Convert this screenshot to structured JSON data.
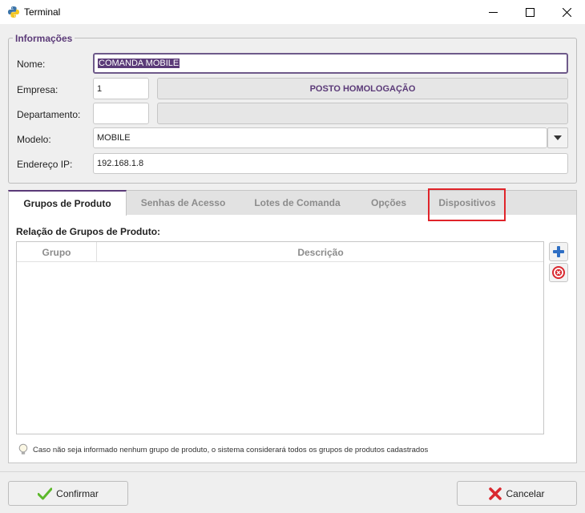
{
  "window": {
    "title": "Terminal",
    "app_icon": "python-icon"
  },
  "info_section": {
    "legend": "Informações",
    "nome_label": "Nome:",
    "nome_value": "COMANDA MOBILE",
    "empresa_label": "Empresa:",
    "empresa_code": "1",
    "empresa_name": "POSTO HOMOLOGAÇÃO",
    "departamento_label": "Departamento:",
    "departamento_code": "",
    "departamento_name": "",
    "modelo_label": "Modelo:",
    "modelo_value": "MOBILE",
    "ip_label": "Endereço IP:",
    "ip_value": "192.168.1.8"
  },
  "tabs": [
    {
      "label": "Grupos de Produto",
      "active": true
    },
    {
      "label": "Senhas de Acesso",
      "active": false
    },
    {
      "label": "Lotes de Comanda",
      "active": false
    },
    {
      "label": "Opções",
      "active": false
    },
    {
      "label": "Dispositivos",
      "active": false
    }
  ],
  "grupos": {
    "section_title": "Relação de Grupos de Produto:",
    "columns": [
      "Grupo",
      "Descrição"
    ],
    "rows": [],
    "hint": "Caso não seja informado nenhum grupo de produto, o sistema considerará todos os grupos de produtos cadastrados"
  },
  "buttons": {
    "confirm": "Confirmar",
    "cancel": "Cancelar"
  },
  "colors": {
    "accent": "#5b3a78",
    "highlight": "#e0242a",
    "add": "#2f6fc4",
    "remove": "#d9282f",
    "confirm_check": "#5cb82b"
  }
}
